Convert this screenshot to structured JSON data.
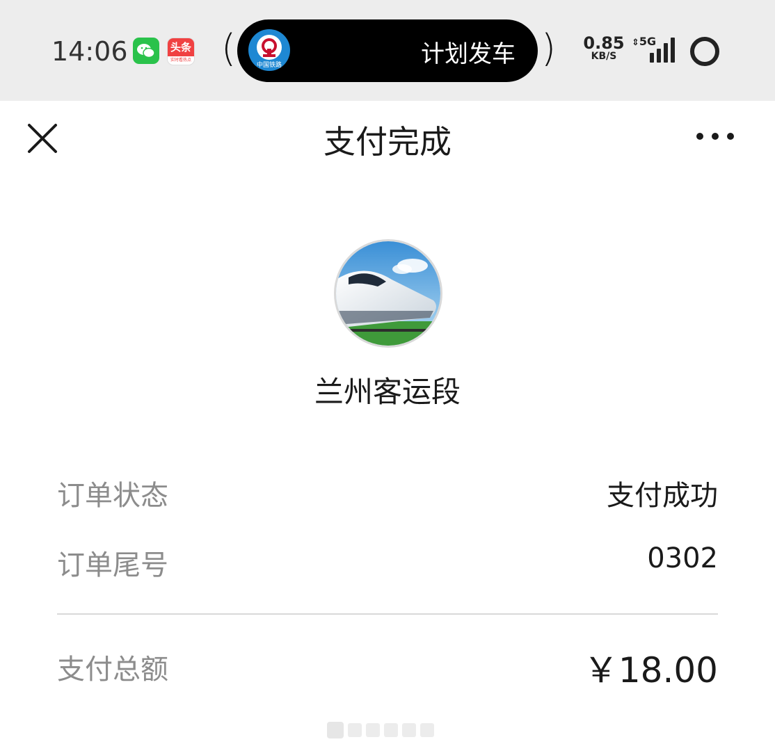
{
  "status_bar": {
    "time": "14:06",
    "notification_icons": [
      "wechat-icon",
      "toutiao-icon"
    ],
    "toutiao_label": "头条",
    "toutiao_sub": "实时看热点",
    "live_activity": {
      "app_icon": "china-railway-icon",
      "app_sub": "中国铁路",
      "text": "计划发车"
    },
    "net_speed_value": "0.85",
    "net_speed_unit": "KB/S",
    "network_label": "5G"
  },
  "nav": {
    "title": "支付完成",
    "close_icon": "close-icon",
    "more_icon": "more-icon"
  },
  "merchant": {
    "name": "兰州客运段",
    "avatar": "train-photo"
  },
  "order": {
    "status_label": "订单状态",
    "status_value": "支付成功",
    "tail_label": "订单尾号",
    "tail_value": "0302",
    "total_label": "支付总额",
    "total_value": "￥18.00"
  },
  "colors": {
    "status_bar_bg": "#ededed",
    "wechat_green": "#2ac24b",
    "railway_blue": "#1e88d3",
    "label_gray": "#8c8c8c",
    "text_dark": "#1a1a1a"
  }
}
